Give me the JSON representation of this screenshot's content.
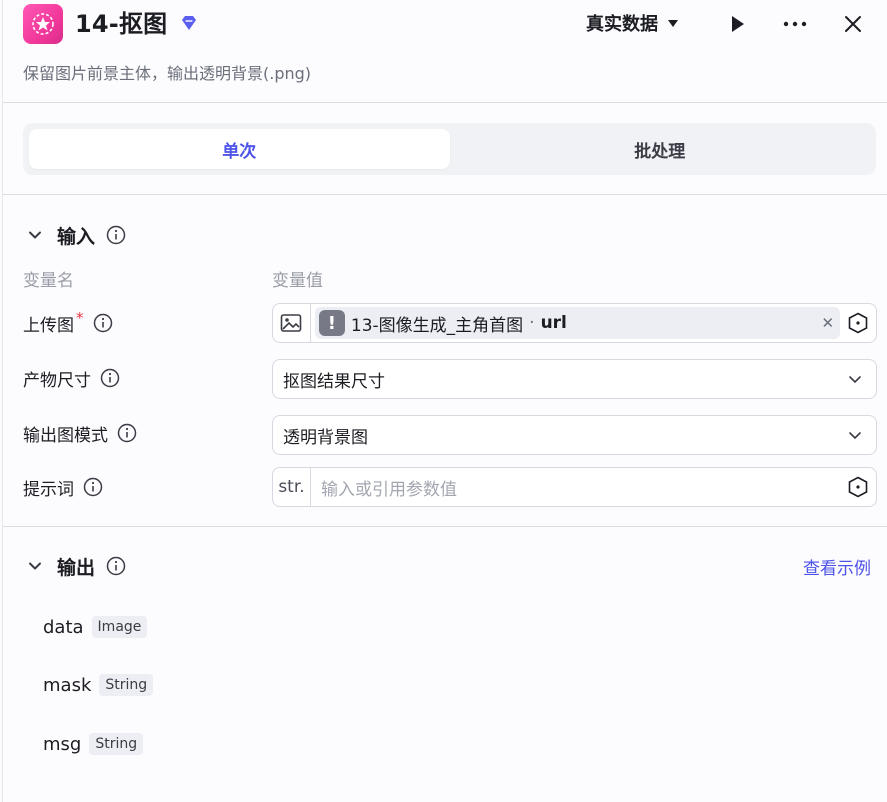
{
  "header": {
    "title": "14-抠图",
    "data_mode_label": "真实数据",
    "description": "保留图片前景主体，输出透明背景(.png)"
  },
  "tabs": [
    {
      "label": "单次",
      "active": true
    },
    {
      "label": "批处理",
      "active": false
    }
  ],
  "input_section": {
    "title": "输入",
    "col_name_label": "变量名",
    "col_value_label": "变量值",
    "fields": [
      {
        "label": "上传图",
        "required": true,
        "ref_source": "13-图像生成_主角首图",
        "ref_separator": "·",
        "ref_field": "url"
      },
      {
        "label": "产物尺寸",
        "value": "抠图结果尺寸"
      },
      {
        "label": "输出图模式",
        "value": "透明背景图"
      },
      {
        "label": "提示词",
        "type_prefix": "str.",
        "placeholder": "输入或引用参数值"
      }
    ]
  },
  "output_section": {
    "title": "输出",
    "example_link": "查看示例",
    "items": [
      {
        "name": "data",
        "type": "Image"
      },
      {
        "name": "mask",
        "type": "String"
      },
      {
        "name": "msg",
        "type": "String"
      }
    ]
  },
  "colors": {
    "accent": "#4d53e8",
    "required": "#e53241",
    "app_icon": "#f2389a"
  },
  "icons": [
    "app-logo-icon",
    "premium-badge-icon",
    "caret-down-icon",
    "play-icon",
    "more-icon",
    "close-icon",
    "chevron-down-icon",
    "info-icon",
    "image-icon",
    "warning-icon",
    "variable-icon"
  ]
}
